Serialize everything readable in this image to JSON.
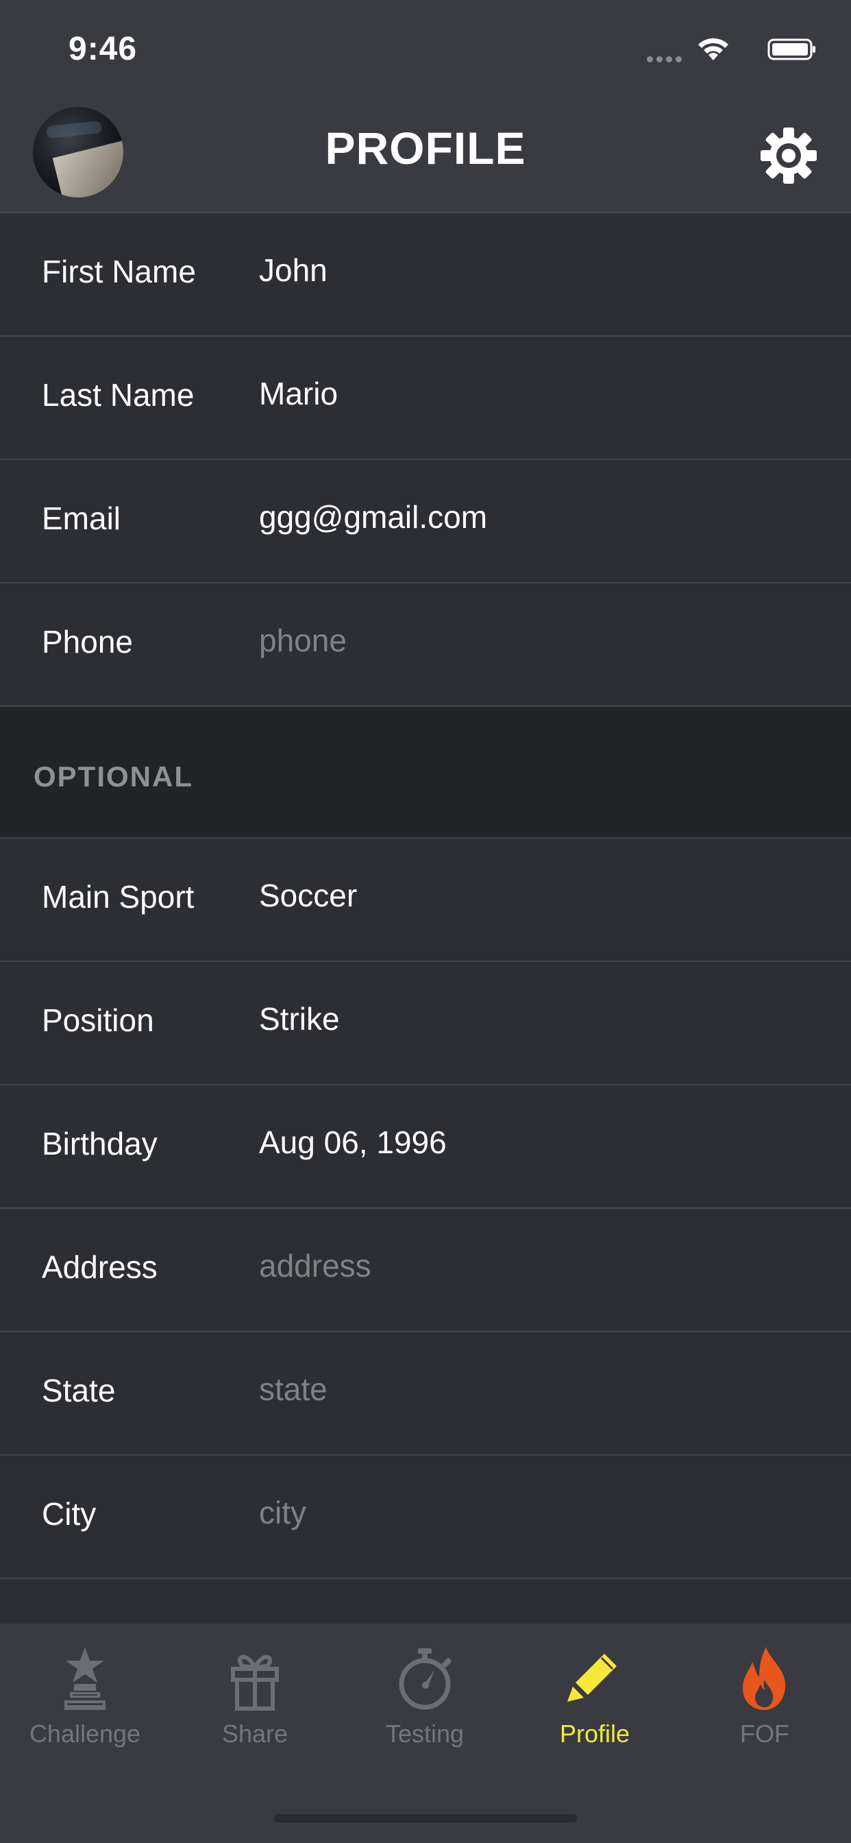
{
  "status_bar": {
    "time": "9:46"
  },
  "header": {
    "title": "PROFILE",
    "settings_icon": "gear-icon",
    "avatar_icon": "avatar"
  },
  "fields": [
    {
      "label": "First Name",
      "value": "John",
      "placeholder": ""
    },
    {
      "label": "Last Name",
      "value": "Mario",
      "placeholder": ""
    },
    {
      "label": "Email",
      "value": "ggg@gmail.com",
      "placeholder": ""
    },
    {
      "label": "Phone",
      "value": "",
      "placeholder": "phone"
    }
  ],
  "optional_section": {
    "header": "OPTIONAL",
    "fields": [
      {
        "label": "Main Sport",
        "value": "Soccer",
        "placeholder": ""
      },
      {
        "label": "Position",
        "value": "Strike",
        "placeholder": ""
      },
      {
        "label": "Birthday",
        "value": "Aug 06, 1996",
        "placeholder": ""
      },
      {
        "label": "Address",
        "value": "",
        "placeholder": "address"
      },
      {
        "label": "State",
        "value": "",
        "placeholder": "state"
      },
      {
        "label": "City",
        "value": "",
        "placeholder": "city"
      }
    ]
  },
  "tab_bar": {
    "active": "Profile",
    "tabs": [
      {
        "label": "Challenge",
        "icon": "trophy-star-icon"
      },
      {
        "label": "Share",
        "icon": "gift-icon"
      },
      {
        "label": "Testing",
        "icon": "stopwatch-icon"
      },
      {
        "label": "Profile",
        "icon": "pencil-icon"
      },
      {
        "label": "FOF",
        "icon": "flame-icon"
      }
    ]
  },
  "colors": {
    "background": "#2d2e33",
    "header": "#393b41",
    "section_header": "#222327",
    "active_tab": "#f4e93b",
    "inactive_tab": "#74767b",
    "placeholder": "#808286",
    "flame": "#e8561c"
  }
}
